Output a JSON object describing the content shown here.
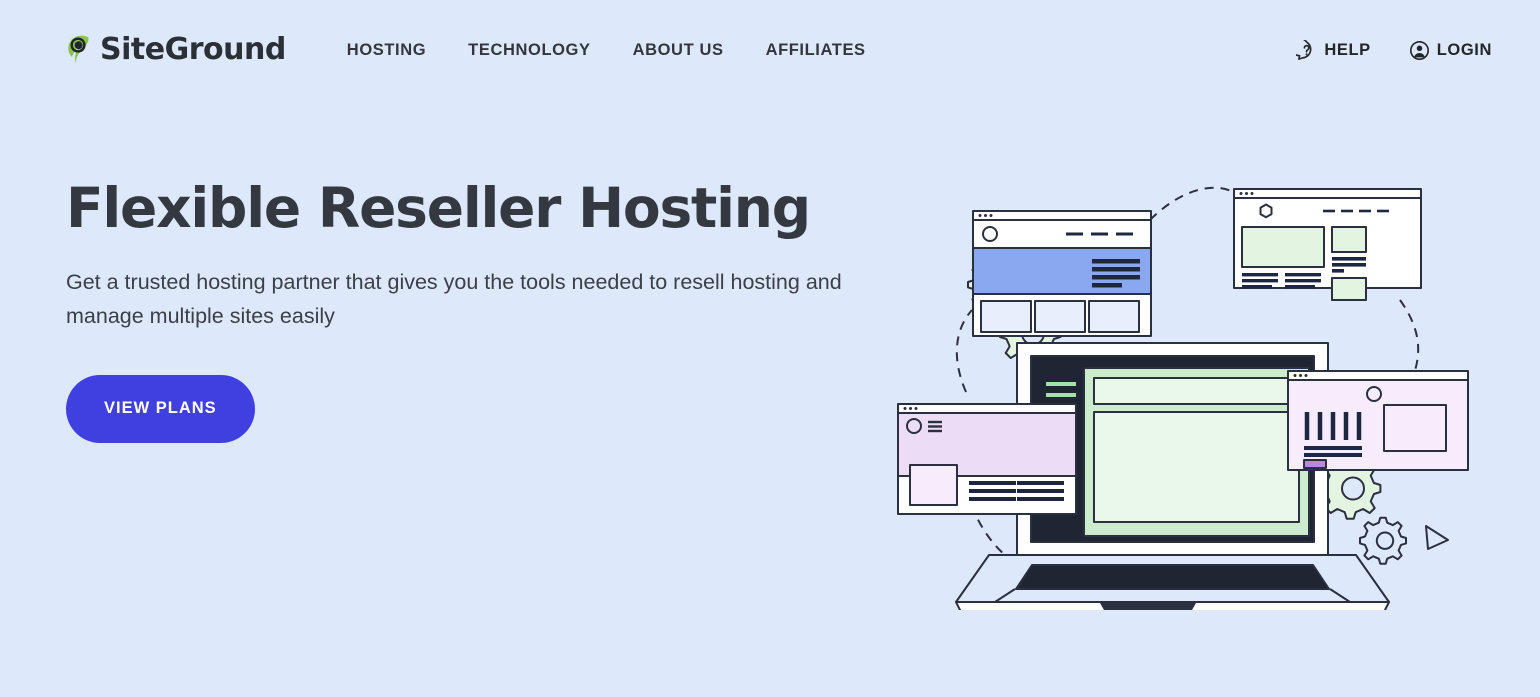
{
  "page": {
    "background_color": "#dde8fa",
    "text_color": "#33373d"
  },
  "header": {
    "logo": {
      "name": "SiteGround",
      "mark_icon": "siteground-leaf-icon",
      "mark_color": "#8bc34a",
      "mark_dark_color": "#1f2430"
    },
    "nav": [
      {
        "label": "HOSTING",
        "name": "nav-item-hosting"
      },
      {
        "label": "TECHNOLOGY",
        "name": "nav-item-technology"
      },
      {
        "label": "ABOUT US",
        "name": "nav-item-about-us"
      },
      {
        "label": "AFFILIATES",
        "name": "nav-item-affiliates"
      }
    ],
    "utilities": [
      {
        "label": "HELP",
        "icon": "question-mark-bubble-icon",
        "name": "help-link"
      },
      {
        "label": "LOGIN",
        "icon": "user-circle-icon",
        "name": "login-link"
      }
    ]
  },
  "hero": {
    "title": "Flexible Reseller Hosting",
    "subtitle": "Get a trusted hosting partner that gives you the tools needed to resell hosting and manage multiple sites easily",
    "cta_label": "VIEW PLANS",
    "cta_color": "#4040e0",
    "cta_text_color": "#ffffff"
  },
  "illustration": {
    "name": "reseller-hosting-illustration",
    "alt": "Laptop surrounded by browser windows, gears and a cursor",
    "colors": {
      "outline": "#2b3040",
      "dark_screen": "#1f2533",
      "green_panel": "#d9f2d9",
      "green_panel_light": "#e8f8e8",
      "blue_band": "#8aa8f0",
      "lavender": "#ecdcf5",
      "lavender_light": "#f7ecfb",
      "purple_chip": "#bb86e0",
      "white": "#ffffff",
      "page_bg": "#dde8fa"
    },
    "elements": [
      {
        "name": "browser-window-top-left",
        "detail": "blue hero band with text lines and three cards"
      },
      {
        "name": "browser-window-top-right",
        "detail": "green content blocks with text bars"
      },
      {
        "name": "laptop",
        "detail": "dark screen with green app panels and sidebar menu"
      },
      {
        "name": "browser-window-left",
        "detail": "lavender hero with circle logo and hamburger menu"
      },
      {
        "name": "browser-window-right",
        "detail": "lavender panel with bar chart and purple button"
      },
      {
        "name": "gear-cluster-left",
        "detail": "two gears"
      },
      {
        "name": "gear-cluster-right",
        "detail": "two gears"
      },
      {
        "name": "cursor-arrow",
        "detail": "triangular pointer"
      },
      {
        "name": "dashed-connector-arcs",
        "detail": "dashed curved lines linking windows"
      }
    ]
  }
}
